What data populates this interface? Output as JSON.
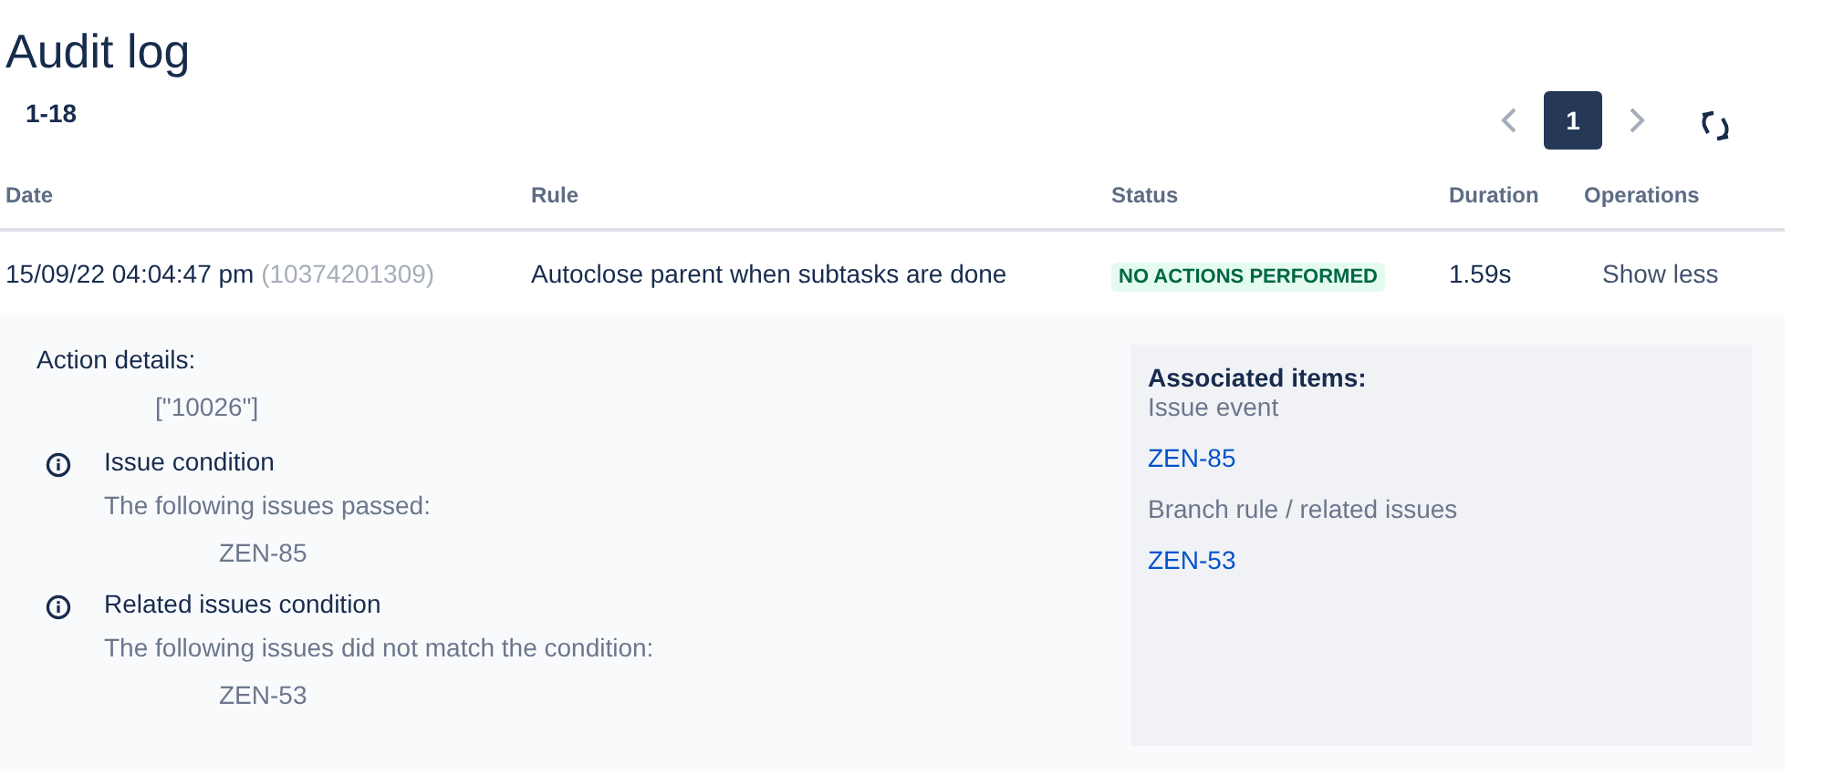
{
  "title": "Audit log",
  "range": "1-18",
  "pagination": {
    "pages": [
      {
        "label": "1",
        "selected": true
      }
    ]
  },
  "table": {
    "columns": [
      "Date",
      "Rule",
      "Status",
      "Duration",
      "Operations"
    ],
    "rows": [
      {
        "date": "15/09/22 04:04:47 pm",
        "id": "(10374201309)",
        "rule": "Autoclose parent when subtasks are done",
        "status": "NO ACTIONS PERFORMED",
        "duration": "1.59s",
        "operation": "Show less",
        "expanded": true,
        "details": {
          "label": "Action details:",
          "value": "[\"10026\"]",
          "conditions": [
            {
              "title": "Issue condition",
              "message": "The following issues passed:",
              "issues": [
                "ZEN-85"
              ]
            },
            {
              "title": "Related issues condition",
              "message": "The following issues did not match the condition:",
              "issues": [
                "ZEN-53"
              ]
            }
          ]
        },
        "associated": {
          "title": "Associated items:",
          "groups": [
            {
              "label": "Issue event",
              "items": [
                "ZEN-85"
              ]
            },
            {
              "label": "Branch rule / related issues",
              "items": [
                "ZEN-53"
              ]
            }
          ]
        }
      }
    ]
  }
}
